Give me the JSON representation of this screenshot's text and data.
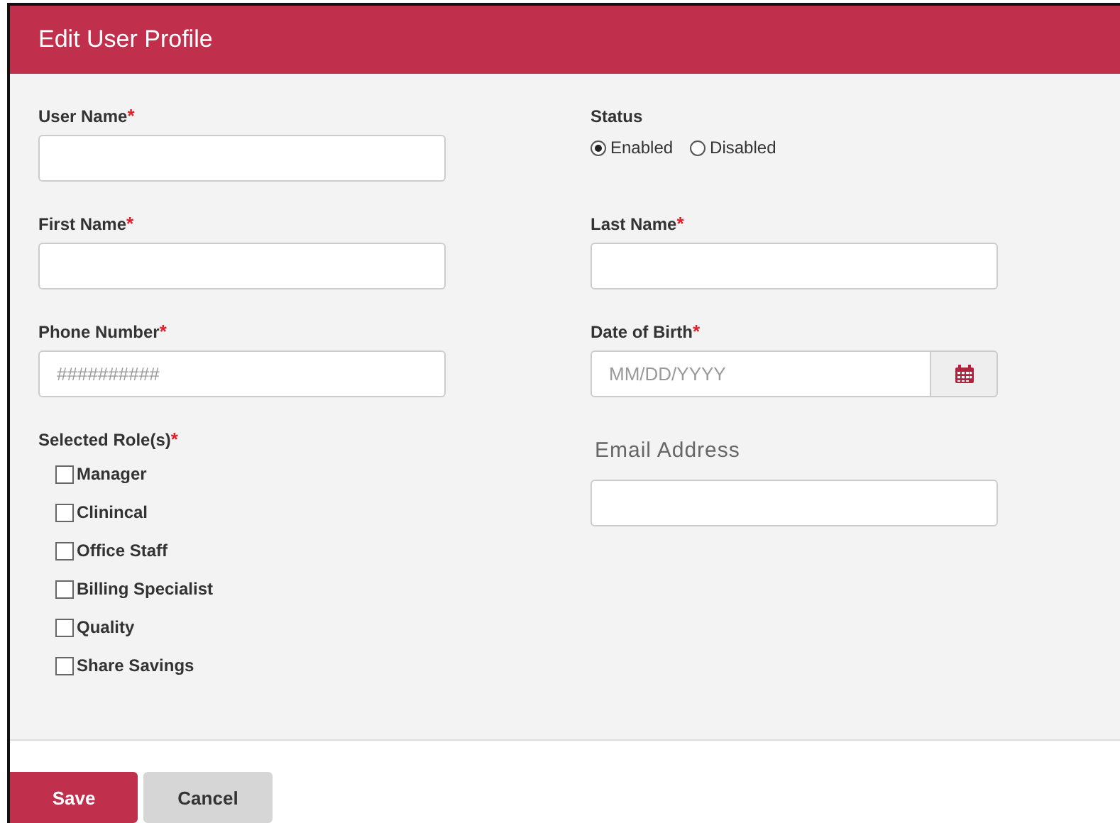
{
  "header": {
    "title": "Edit User Profile"
  },
  "left": [
    {
      "kind": "text",
      "label": "User Name",
      "mark": "*"
    },
    {
      "kind": "text",
      "label": "First Name",
      "mark": "*"
    },
    {
      "kind": "text",
      "label": "Phone Number",
      "mark": "*",
      "placeholder": "##########"
    },
    {
      "kind": "checklist",
      "label": "Selected Role(s)",
      "mark": "*",
      "options": [
        {
          "label": "Manager",
          "checked": false
        },
        {
          "label": "Clinincal",
          "checked": false
        },
        {
          "label": "Office Staff",
          "checked": false
        },
        {
          "label": "Billing Specialist",
          "checked": false
        },
        {
          "label": "Quality",
          "checked": false
        },
        {
          "label": "Share Savings",
          "checked": false
        }
      ]
    }
  ],
  "right": [
    {
      "kind": "radio",
      "label": "Status",
      "options": [
        {
          "label": "Enabled",
          "selected": true
        },
        {
          "label": "Disabled",
          "selected": false
        }
      ]
    },
    {
      "kind": "text",
      "label": "Last Name",
      "mark": "*"
    },
    {
      "kind": "date",
      "label": "Date of Birth",
      "mark": "*",
      "placeholder": "MM/DD/YYYY"
    },
    {
      "kind": "outlined",
      "label": "Email Address"
    }
  ],
  "buttons": [
    {
      "label": "Save",
      "kind": "primary"
    },
    {
      "label": "Cancel",
      "kind": "secondary"
    }
  ]
}
